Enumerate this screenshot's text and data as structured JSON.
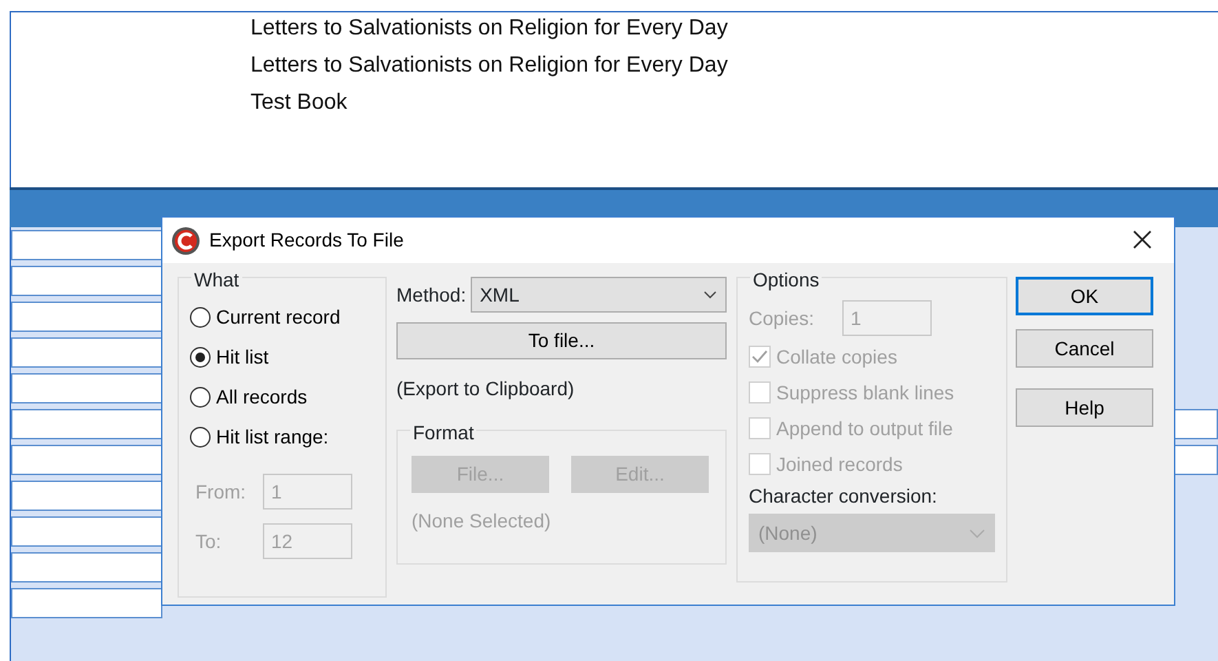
{
  "record_list": {
    "items": [
      "Letters to Salvationists on Religion for Every Day",
      "Letters to Salvationists on Religion for Every Day",
      "Test Book"
    ]
  },
  "dialog": {
    "title": "Export Records To File",
    "what": {
      "legend": "What",
      "options": [
        {
          "label": "Current record",
          "selected": false
        },
        {
          "label": "Hit list",
          "selected": true
        },
        {
          "label": "All records",
          "selected": false
        },
        {
          "label": "Hit list range:",
          "selected": false
        }
      ],
      "from": {
        "label": "From:",
        "value": "1",
        "disabled": true
      },
      "to": {
        "label": "To:",
        "value": "12",
        "disabled": true
      }
    },
    "method": {
      "label": "Method:",
      "value": "XML"
    },
    "to_file_button": "To file...",
    "clipboard_note": "(Export to Clipboard)",
    "format": {
      "legend": "Format",
      "buttons": [
        {
          "label": "File...",
          "disabled": true
        },
        {
          "label": "Edit...",
          "disabled": true
        }
      ],
      "selection": "(None Selected)",
      "disabled": true
    },
    "options": {
      "legend": "Options",
      "copies": {
        "label": "Copies:",
        "value": "1",
        "disabled": true
      },
      "checkboxes": [
        {
          "label": "Collate copies",
          "checked": true,
          "disabled": true
        },
        {
          "label": "Suppress blank lines",
          "checked": false,
          "disabled": true
        },
        {
          "label": "Append to output file",
          "checked": false,
          "disabled": true
        },
        {
          "label": "Joined records",
          "checked": false,
          "disabled": true
        }
      ],
      "conversion": {
        "label": "Character conversion:",
        "value": "(None)",
        "disabled": true
      }
    },
    "buttons": [
      {
        "label": "OK",
        "default": true
      },
      {
        "label": "Cancel",
        "default": false
      },
      {
        "label": "Help",
        "default": false
      }
    ]
  }
}
